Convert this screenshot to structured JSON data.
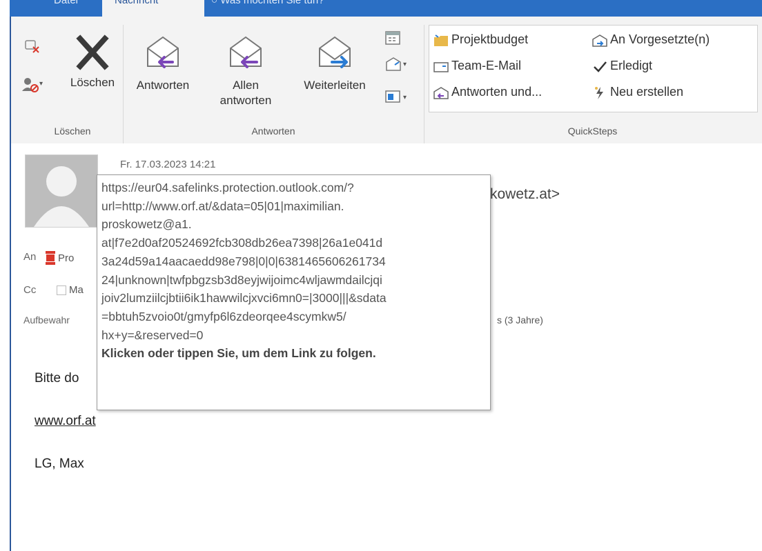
{
  "tabs": [
    "Datei",
    "Nachricht",
    "Was möchten Sie tun?"
  ],
  "ribbon": {
    "delete_group": {
      "delete_label": "Löschen",
      "group_label": "Löschen"
    },
    "respond_group": {
      "reply_label": "Antworten",
      "reply_all_line1": "Allen",
      "reply_all_line2": "antworten",
      "forward_label": "Weiterleiten",
      "group_label": "Antworten"
    },
    "quicksteps": {
      "items": [
        "Projektbudget",
        "Team-E-Mail",
        "Antworten und...",
        "An Vorgesetzte(n)",
        "Erledigt",
        "Neu erstellen"
      ],
      "group_label": "QuickSteps"
    }
  },
  "message": {
    "date": "Fr. 17.03.2023 14:21",
    "from_tail": "kowetz.at>",
    "to_label": "An",
    "to_value": "Pro",
    "cc_label": "Cc",
    "cc_value": "Ma",
    "retention_label": "Aufbewahr",
    "retention_tail": "s (3 Jahre)"
  },
  "tooltip": {
    "lines": [
      "https://eur04.safelinks.protection.outlook.com/?",
      "url=http://www.orf.at/&data=05|01|maximilian.",
      "proskowetz@a1.",
      "at|f7e2d0af20524692fcb308db26ea7398|26a1e041d",
      "3a24d59a14aacaedd98e798|0|0|6381465606261734",
      "24|unknown|twfpbgzsb3d8eyjwijoimc4wljawmdailcjqi",
      "joiv2lumziilcjbtii6ik1hawwilcjxvci6mn0=|3000|||&sdata",
      "=bbtuh5zvoio0t/gmyfp6l6zdeorqee4scymkw5/",
      "hx+y=&reserved=0"
    ],
    "hint": "Klicken oder tippen Sie, um dem Link zu folgen."
  },
  "body": {
    "line1": "Bitte do",
    "link": "www.orf.at",
    "signature": "LG, Max"
  },
  "colors": {
    "accent": "#2b6fc4",
    "purple_arrow": "#7b46b8",
    "blue_arrow": "#2b7cd3",
    "link": "#0563c1"
  }
}
